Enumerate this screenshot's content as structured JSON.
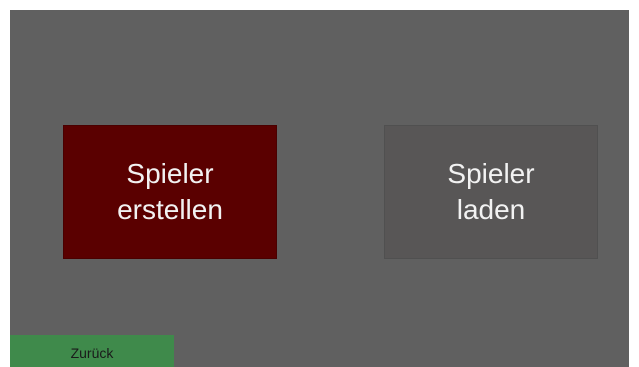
{
  "buttons": {
    "create_player": {
      "line1": "Spieler",
      "line2": "erstellen"
    },
    "load_player": {
      "line1": "Spieler",
      "line2": "laden"
    },
    "back": {
      "label": "Zurück"
    }
  },
  "colors": {
    "background": "#606060",
    "create_button": "#5a0000",
    "load_button": "#585656",
    "back_button": "#3f8a4b",
    "button_text": "#f2f2f2"
  }
}
